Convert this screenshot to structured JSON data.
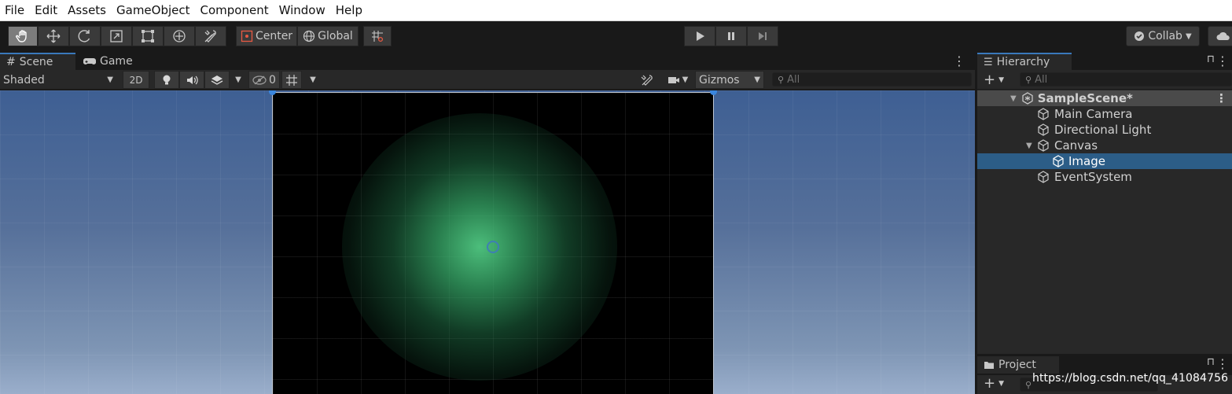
{
  "menu": [
    "File",
    "Edit",
    "Assets",
    "GameObject",
    "Component",
    "Window",
    "Help"
  ],
  "toolbar": {
    "tools": [
      "hand-tool",
      "move-tool",
      "rotate-tool",
      "scale-tool",
      "rect-tool",
      "transform-tool",
      "custom-tool"
    ],
    "pivot_label": "Center",
    "space_label": "Global",
    "collab_label": "Collab"
  },
  "scene_tabs": [
    {
      "label": "Scene",
      "icon": "hash-icon",
      "active": true
    },
    {
      "label": "Game",
      "icon": "gamepad-icon",
      "active": false
    }
  ],
  "scene_toolbar": {
    "draw_mode": "Shaded",
    "mode_2d": "2D",
    "hidden_count": "0",
    "gizmos_label": "Gizmos",
    "search_placeholder": "All"
  },
  "hierarchy": {
    "tab_label": "Hierarchy",
    "search_placeholder": "All",
    "scene_name": "SampleScene*",
    "items": [
      {
        "label": "Main Camera",
        "depth": 1,
        "selected": false
      },
      {
        "label": "Directional Light",
        "depth": 1,
        "selected": false
      },
      {
        "label": "Canvas",
        "depth": 1,
        "selected": false,
        "expanded": true
      },
      {
        "label": "Image",
        "depth": 2,
        "selected": true
      },
      {
        "label": "EventSystem",
        "depth": 1,
        "selected": false
      }
    ]
  },
  "project": {
    "tab_label": "Project",
    "watermark": "https://blog.csdn.net/qq_41084756"
  },
  "colors": {
    "selection": "#2c5d87",
    "accent_tab": "#3a79bb",
    "glow": "#50c882"
  }
}
